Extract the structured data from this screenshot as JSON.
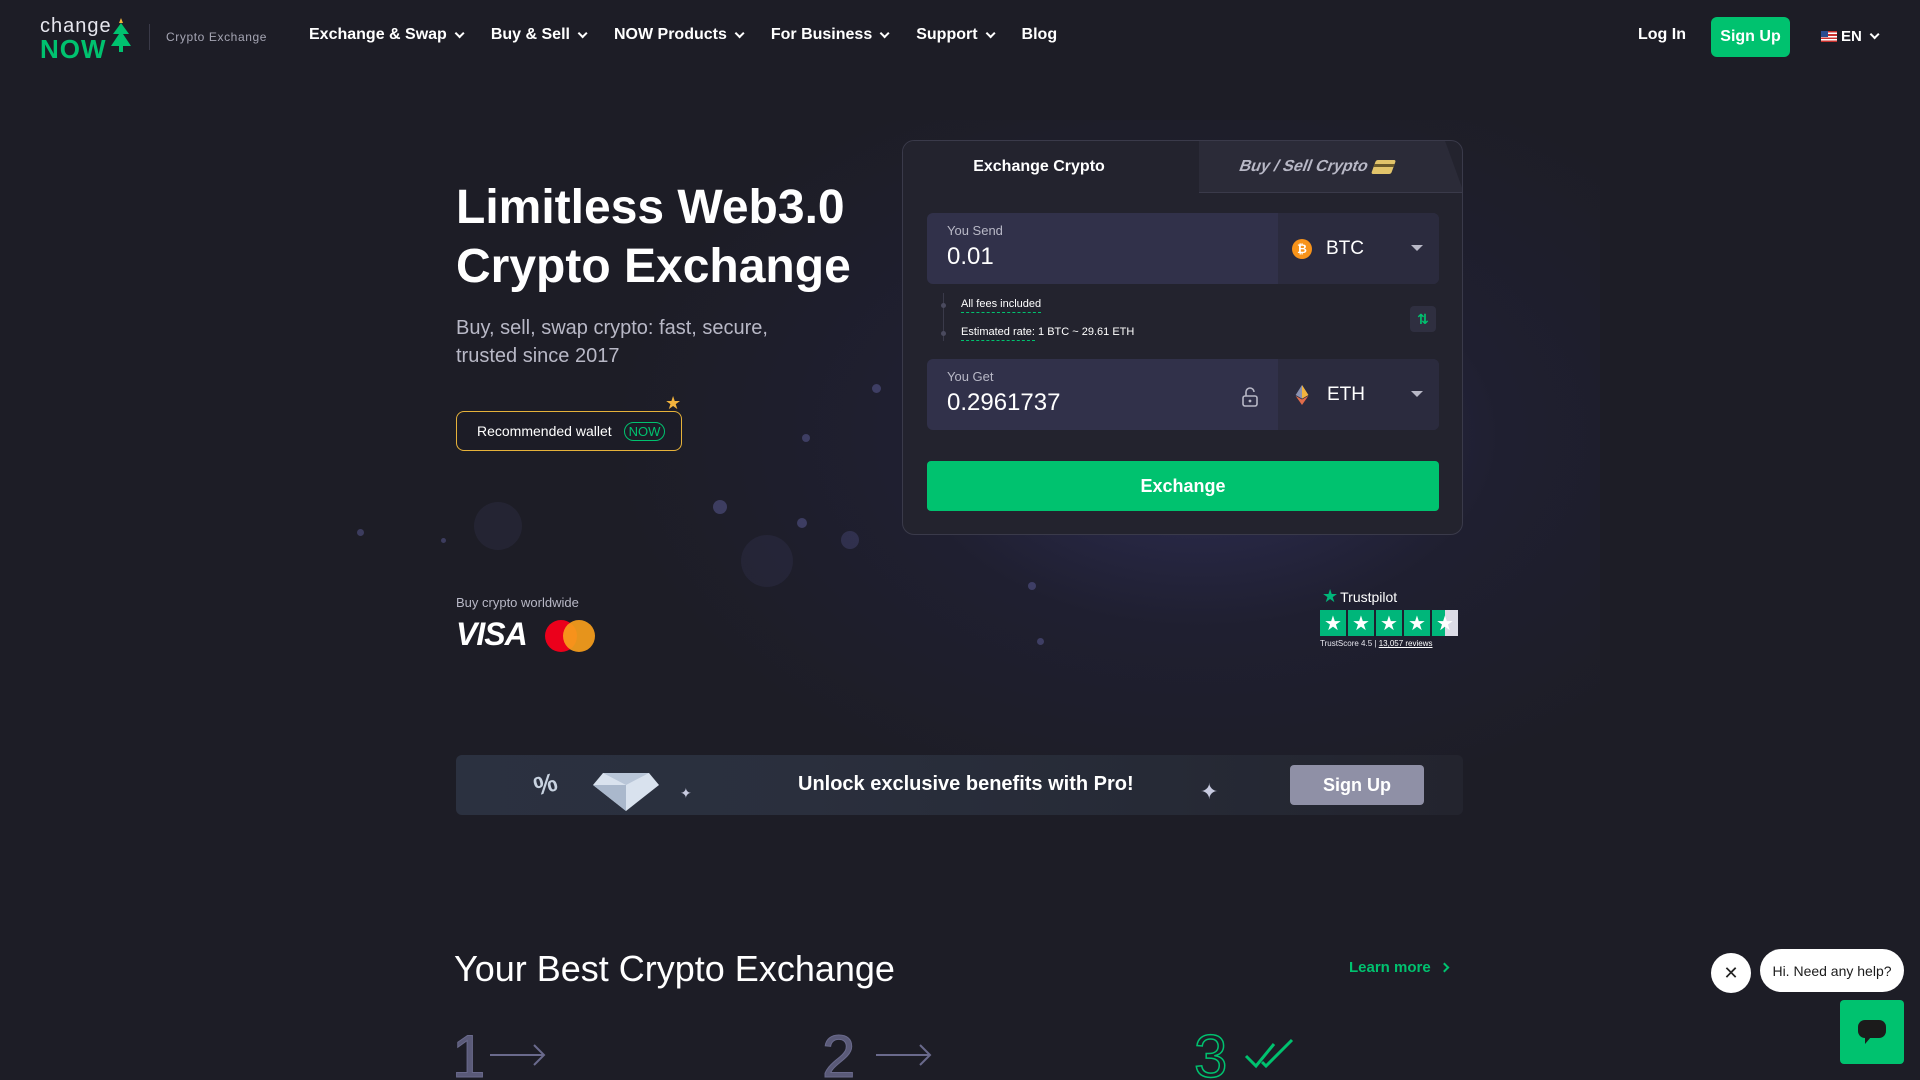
{
  "header": {
    "logo_top": "change",
    "logo_bottom": "NOW",
    "logo_subtitle": "Crypto Exchange",
    "nav": [
      {
        "label": "Exchange & Swap",
        "has_dropdown": true
      },
      {
        "label": "Buy & Sell",
        "has_dropdown": true
      },
      {
        "label": "NOW Products",
        "has_dropdown": true
      },
      {
        "label": "For Business",
        "has_dropdown": true
      },
      {
        "label": "Support",
        "has_dropdown": true
      },
      {
        "label": "Blog",
        "has_dropdown": false
      }
    ],
    "login": "Log In",
    "signup": "Sign Up",
    "language": "EN"
  },
  "hero": {
    "title_line1": "Limitless Web3.0",
    "title_line2": "Crypto Exchange",
    "subtitle": "Buy, sell, swap crypto: fast, secure, trusted since 2017",
    "wallet_button": "Recommended wallet",
    "wallet_badge": "NOW",
    "buy_worldwide": "Buy crypto worldwide",
    "visa": "VISA"
  },
  "widget": {
    "tab_exchange": "Exchange Crypto",
    "tab_buysell": "Buy / Sell Crypto",
    "send_label": "You Send",
    "send_value": "0.01",
    "send_currency": "BTC",
    "fees": "All fees included",
    "rate_label": "Estimated rate:",
    "rate_value": "1 BTC ~ 29.61 ETH",
    "get_label": "You Get",
    "get_value": "0.2961737",
    "get_currency": "ETH",
    "exchange_button": "Exchange"
  },
  "trustpilot": {
    "name": "Trustpilot",
    "score_label": "TrustScore 4.5",
    "reviews": "13,057 reviews",
    "rating": 4.5
  },
  "promo": {
    "text": "Unlock exclusive benefits with Pro!",
    "button": "Sign Up"
  },
  "best": {
    "title": "Your Best Crypto Exchange",
    "learn_more": "Learn more",
    "steps": [
      "1",
      "2",
      "3"
    ]
  },
  "chat": {
    "bubble": "Hi. Need any help?"
  },
  "colors": {
    "accent": "#00c26f",
    "background": "#1d1d26",
    "wallet_border": "#e6b23a",
    "btc": "#f7931a"
  }
}
